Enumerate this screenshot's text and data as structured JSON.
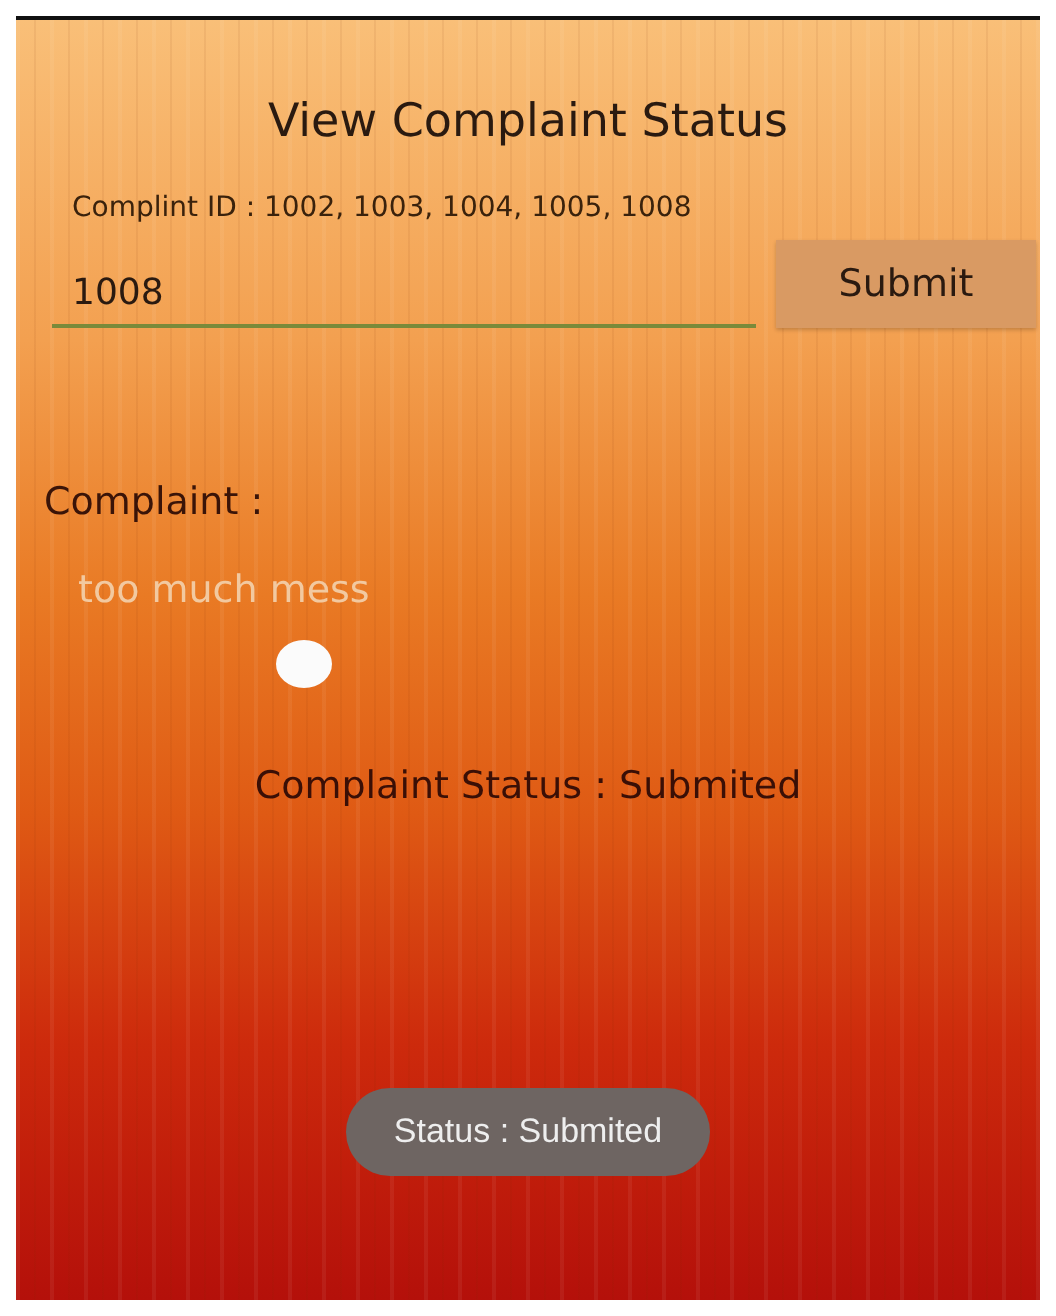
{
  "title": "View Complaint Status",
  "id_hint": "Complint ID : 1002, 1003, 1004, 1005, 1008",
  "id_field": {
    "value": "1008"
  },
  "submit_button": "Submit",
  "complaint_label": "Complaint  :",
  "complaint_text": "too much mess",
  "status_line": "Complaint Status : Submited",
  "toast": "Status : Submited"
}
